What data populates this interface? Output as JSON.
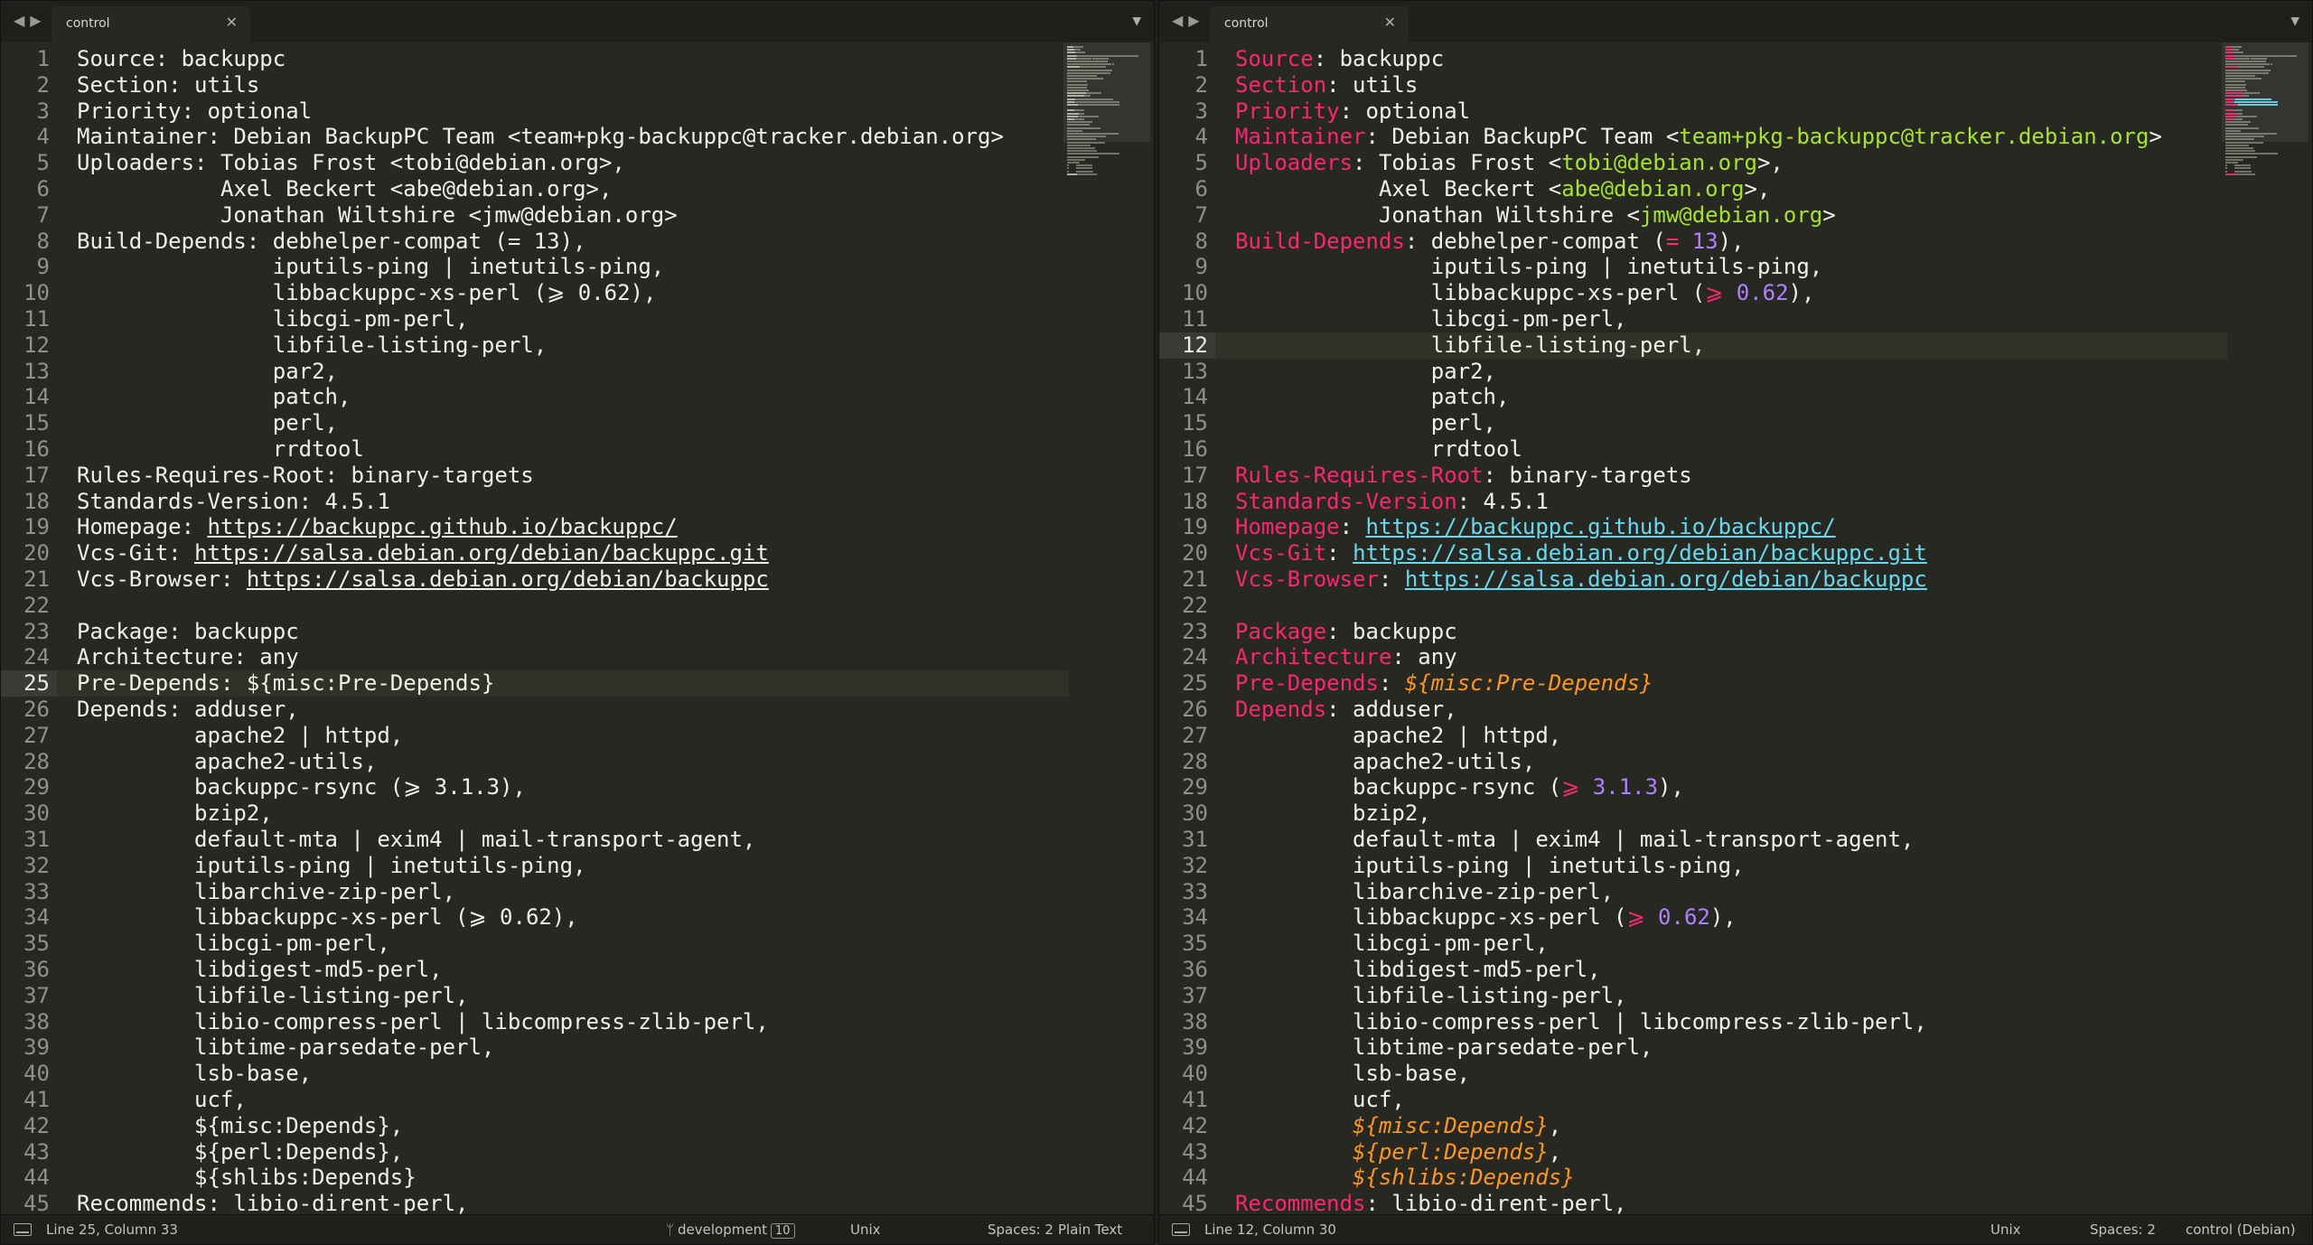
{
  "tab_title": "control",
  "icons": {
    "nav": "nav-arrows-icon",
    "close": "close-icon",
    "menu": "chevron-down-icon",
    "panel": "panel-toggle-icon",
    "branch": "git-branch-icon"
  },
  "colors": {
    "background": "#272822",
    "keyword": "#f92672",
    "email": "#a6e22e",
    "url": "#66d9ef",
    "number": "#ae81ff",
    "substvar": "#fd971f"
  },
  "lines": [
    [
      [
        "k",
        "Source"
      ],
      [
        "v",
        ": backuppc"
      ]
    ],
    [
      [
        "k",
        "Section"
      ],
      [
        "v",
        ": utils"
      ]
    ],
    [
      [
        "k",
        "Priority"
      ],
      [
        "v",
        ": optional"
      ]
    ],
    [
      [
        "k",
        "Maintainer"
      ],
      [
        "v",
        ": Debian BackupPC Team <"
      ],
      [
        "em",
        "team+pkg-backuppc@tracker.debian.org"
      ],
      [
        "v",
        ">"
      ]
    ],
    [
      [
        "k",
        "Uploaders"
      ],
      [
        "v",
        ": Tobias Frost <"
      ],
      [
        "em",
        "tobi@debian.org"
      ],
      [
        "v",
        ">,"
      ]
    ],
    [
      [
        "v",
        "           Axel Beckert <"
      ],
      [
        "em",
        "abe@debian.org"
      ],
      [
        "v",
        ">,"
      ]
    ],
    [
      [
        "v",
        "           Jonathan Wiltshire <"
      ],
      [
        "em",
        "jmw@debian.org"
      ],
      [
        "v",
        ">"
      ]
    ],
    [
      [
        "k",
        "Build-Depends"
      ],
      [
        "v",
        ": debhelper-compat ("
      ],
      [
        "op",
        "="
      ],
      [
        "v",
        " "
      ],
      [
        "num",
        "13"
      ],
      [
        "v",
        "),"
      ]
    ],
    [
      [
        "v",
        "               iputils-ping | inetutils-ping,"
      ]
    ],
    [
      [
        "v",
        "               libbackuppc-xs-perl ("
      ],
      [
        "op",
        "⩾"
      ],
      [
        "v",
        " "
      ],
      [
        "num",
        "0.62"
      ],
      [
        "v",
        "),"
      ]
    ],
    [
      [
        "v",
        "               libcgi-pm-perl,"
      ]
    ],
    [
      [
        "v",
        "               libfile-listing-perl,"
      ]
    ],
    [
      [
        "v",
        "               par2,"
      ]
    ],
    [
      [
        "v",
        "               patch,"
      ]
    ],
    [
      [
        "v",
        "               perl,"
      ]
    ],
    [
      [
        "v",
        "               rrdtool"
      ]
    ],
    [
      [
        "k",
        "Rules-Requires-Root"
      ],
      [
        "v",
        ": binary-targets"
      ]
    ],
    [
      [
        "k",
        "Standards-Version"
      ],
      [
        "v",
        ": 4.5.1"
      ]
    ],
    [
      [
        "k",
        "Homepage"
      ],
      [
        "v",
        ": "
      ],
      [
        "url",
        "https://backuppc.github.io/backuppc/"
      ]
    ],
    [
      [
        "k",
        "Vcs-Git"
      ],
      [
        "v",
        ": "
      ],
      [
        "url",
        "https://salsa.debian.org/debian/backuppc.git"
      ]
    ],
    [
      [
        "k",
        "Vcs-Browser"
      ],
      [
        "v",
        ": "
      ],
      [
        "url",
        "https://salsa.debian.org/debian/backuppc"
      ]
    ],
    [],
    [
      [
        "k",
        "Package"
      ],
      [
        "v",
        ": backuppc"
      ]
    ],
    [
      [
        "k",
        "Architecture"
      ],
      [
        "v",
        ": any"
      ]
    ],
    [
      [
        "k",
        "Pre-Depends"
      ],
      [
        "v",
        ": "
      ],
      [
        "subst",
        "${misc:Pre-Depends}"
      ]
    ],
    [
      [
        "k",
        "Depends"
      ],
      [
        "v",
        ": adduser,"
      ]
    ],
    [
      [
        "v",
        "         apache2 | httpd,"
      ]
    ],
    [
      [
        "v",
        "         apache2-utils,"
      ]
    ],
    [
      [
        "v",
        "         backuppc-rsync ("
      ],
      [
        "op",
        "⩾"
      ],
      [
        "v",
        " "
      ],
      [
        "num",
        "3.1.3"
      ],
      [
        "v",
        "),"
      ]
    ],
    [
      [
        "v",
        "         bzip2,"
      ]
    ],
    [
      [
        "v",
        "         default-mta | exim4 | mail-transport-agent,"
      ]
    ],
    [
      [
        "v",
        "         iputils-ping | inetutils-ping,"
      ]
    ],
    [
      [
        "v",
        "         libarchive-zip-perl,"
      ]
    ],
    [
      [
        "v",
        "         libbackuppc-xs-perl ("
      ],
      [
        "op",
        "⩾"
      ],
      [
        "v",
        " "
      ],
      [
        "num",
        "0.62"
      ],
      [
        "v",
        "),"
      ]
    ],
    [
      [
        "v",
        "         libcgi-pm-perl,"
      ]
    ],
    [
      [
        "v",
        "         libdigest-md5-perl,"
      ]
    ],
    [
      [
        "v",
        "         libfile-listing-perl,"
      ]
    ],
    [
      [
        "v",
        "         libio-compress-perl | libcompress-zlib-perl,"
      ]
    ],
    [
      [
        "v",
        "         libtime-parsedate-perl,"
      ]
    ],
    [
      [
        "v",
        "         lsb-base,"
      ]
    ],
    [
      [
        "v",
        "         ucf,"
      ]
    ],
    [
      [
        "v",
        "         "
      ],
      [
        "subst",
        "${misc:Depends}"
      ],
      [
        "v",
        ","
      ]
    ],
    [
      [
        "v",
        "         "
      ],
      [
        "subst",
        "${perl:Depends}"
      ],
      [
        "v",
        ","
      ]
    ],
    [
      [
        "v",
        "         "
      ],
      [
        "subst",
        "${shlibs:Depends}"
      ]
    ],
    [
      [
        "k",
        "Recommends"
      ],
      [
        "v",
        ": libio-dirent-perl,"
      ]
    ]
  ],
  "panes": [
    {
      "name": "left-pane",
      "highlighting": false,
      "current_line": 25,
      "status": {
        "position": "Line 25, Column 33",
        "branch": "development",
        "branch_badge": "10",
        "line_endings": "Unix",
        "indent": "Spaces: 2",
        "syntax": "Plain Text"
      }
    },
    {
      "name": "right-pane",
      "highlighting": true,
      "current_line": 12,
      "status": {
        "position": "Line 12, Column 30",
        "line_endings": "Unix",
        "indent": "Spaces: 2",
        "syntax": "control (Debian)"
      }
    }
  ]
}
